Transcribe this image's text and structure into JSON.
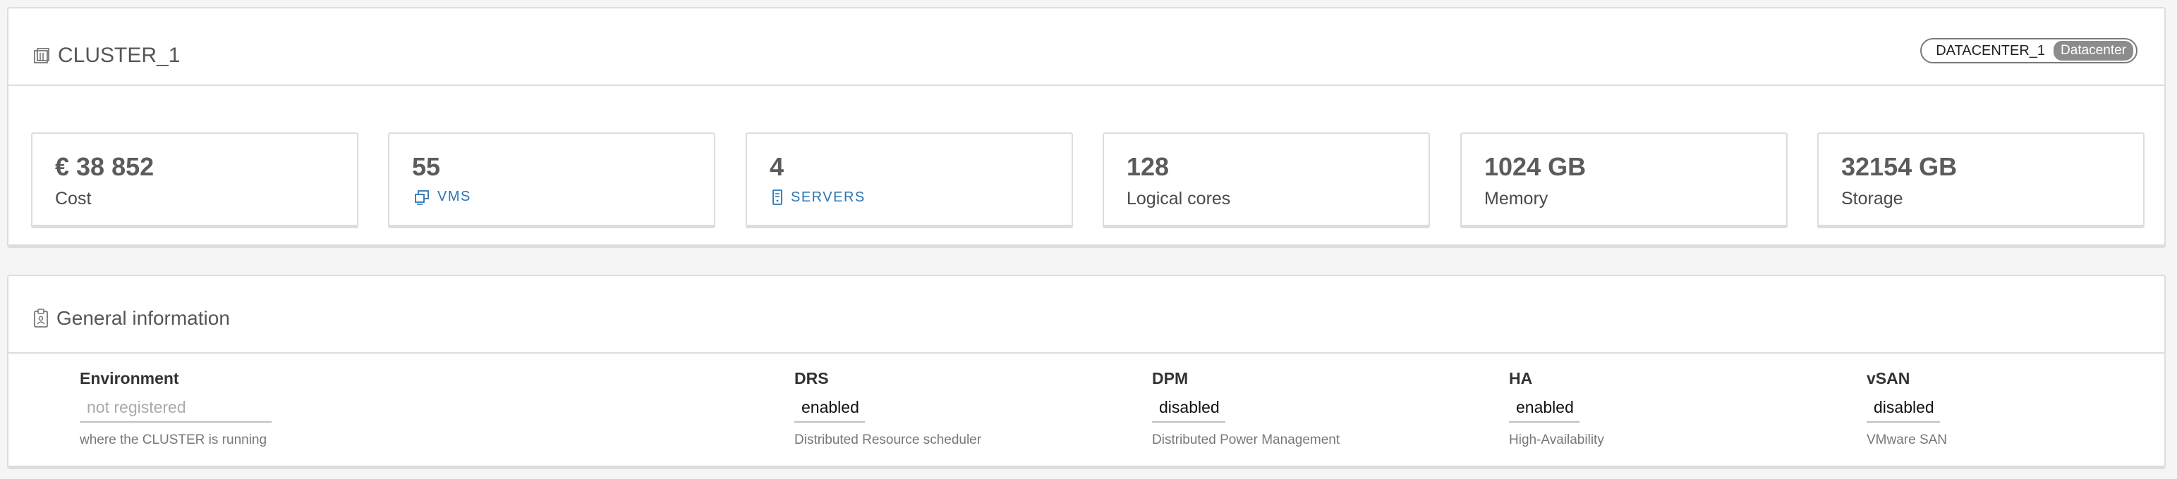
{
  "cluster": {
    "title": "CLUSTER_1",
    "title_icon": "cluster-icon",
    "datacenter_name": "DATACENTER_1",
    "datacenter_type": "Datacenter"
  },
  "tiles": [
    {
      "value": "€ 38 852",
      "label": "Cost"
    },
    {
      "value": "55",
      "label": "VMS",
      "icon": "vm-icon"
    },
    {
      "value": "4",
      "label": "SERVERS",
      "icon": "server-icon"
    },
    {
      "value": "128",
      "label": "Logical cores"
    },
    {
      "value": "1024 GB",
      "label": "Memory"
    },
    {
      "value": "32154 GB",
      "label": "Storage"
    }
  ],
  "general": {
    "title": "General information",
    "title_icon": "clipboard-icon",
    "fields": [
      {
        "label": "Environment",
        "value": "",
        "placeholder": "not registered",
        "help": "where the CLUSTER is running"
      },
      {
        "label": "DRS",
        "value": "enabled",
        "help": "Distributed Resource scheduler"
      },
      {
        "label": "DPM",
        "value": "disabled",
        "help": "Distributed Power Management"
      },
      {
        "label": "HA",
        "value": "enabled",
        "help": "High-Availability"
      },
      {
        "label": "vSAN",
        "value": "disabled",
        "help": "VMware SAN"
      }
    ]
  },
  "colors": {
    "link": "#2b75b3",
    "border": "#dddddd",
    "badge_type_bg": "#8c8c8c"
  }
}
